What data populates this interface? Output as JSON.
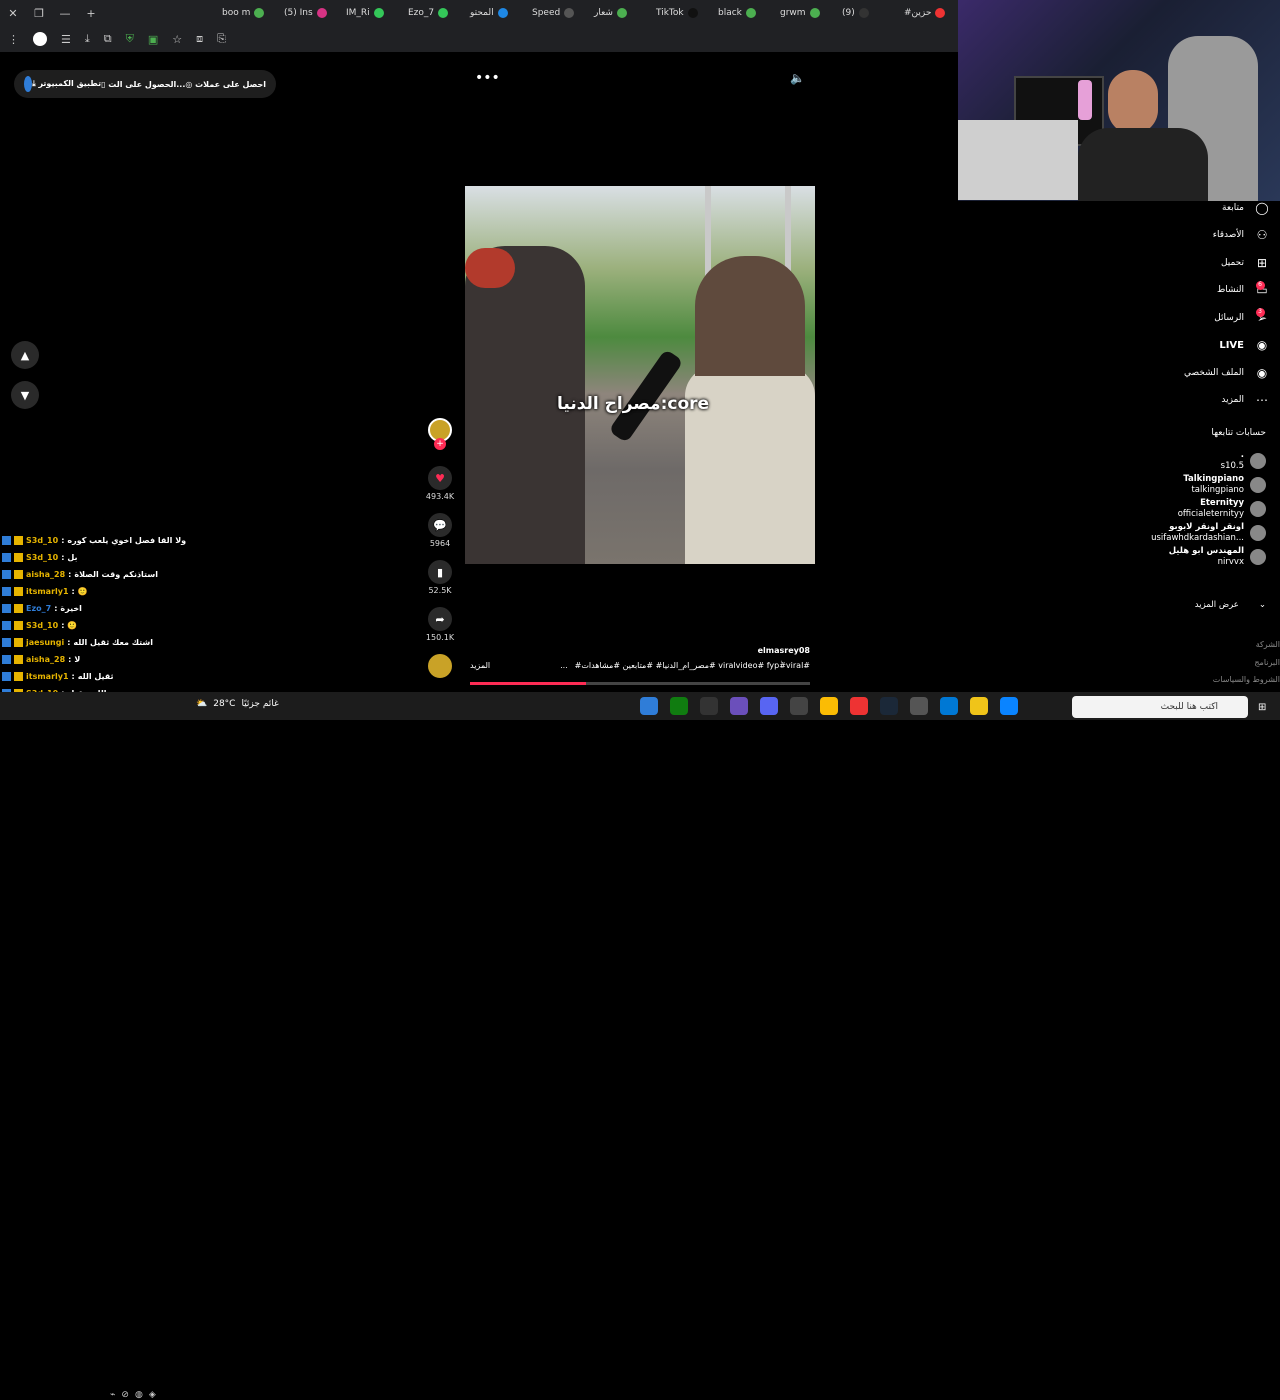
{
  "browser": {
    "tabs": [
      {
        "label": "‎#حزين",
        "color": "#e33"
      },
      {
        "label": "(9)",
        "color": "#333"
      },
      {
        "label": "grwm",
        "color": "#4caf50"
      },
      {
        "label": "black",
        "color": "#4caf50"
      },
      {
        "label": "TikTok",
        "color": "#111"
      },
      {
        "label": "شعار",
        "color": "#4caf50"
      },
      {
        "label": "Speed",
        "color": "#555"
      },
      {
        "label": "المحتو",
        "color": "#1e88e5"
      },
      {
        "label": "Ezo_7",
        "color": "#34c759"
      },
      {
        "label": "IM_Ri",
        "color": "#34c759"
      },
      {
        "label": "(5) Ins",
        "color": "#d63384"
      },
      {
        "label": "boo m",
        "color": "#4caf50"
      }
    ],
    "new_tab": "+",
    "minimize": "—"
  },
  "header": {
    "get_coins": "احصل على عملات",
    "get_app": "الحصول على الت...",
    "pc_app": "تطبيق الكمبيوتر"
  },
  "video": {
    "caption": "مصراح الدنيا:core",
    "likes": "493.4K",
    "comments": "5964",
    "saves": "52.5K",
    "shares": "150.1K",
    "username": "elmasrey08",
    "hashtags": "#مصر_ام_الدنيا# #متابعين #مشاهدات# viralvideo# fyp#ٰviral#",
    "more": "المزيد",
    "ellipsis": "...",
    "progress": 0.34
  },
  "nav": {
    "up": "▲",
    "down": "▼"
  },
  "chat": [
    {
      "user": "S3d_10",
      "user_color": "#e6b400",
      "msg": "ولا القا فصل اخوي يلعب كوره"
    },
    {
      "user": "S3d_10",
      "user_color": "#e6b400",
      "msg": "بل"
    },
    {
      "user": "aisha_28",
      "user_color": "#e6b400",
      "msg": "استاذنكم وقت الصلاة"
    },
    {
      "user": "itsmarly1",
      "user_color": "#e6b400",
      "msg": "🙂"
    },
    {
      "user": "Ezo_7",
      "user_color": "#2f7dd8",
      "msg": "اخيرة"
    },
    {
      "user": "S3d_10",
      "user_color": "#e6b400",
      "msg": "🙂"
    },
    {
      "user": "jaesungi",
      "user_color": "#e6b400",
      "msg": "اشتك معك ثقيل الله"
    },
    {
      "user": "aisha_28",
      "user_color": "#e6b400",
      "msg": "لا"
    },
    {
      "user": "itsmarly1",
      "user_color": "#e6b400",
      "msg": "ثقيل الله"
    },
    {
      "user": "S3d_10",
      "user_color": "#e6b400",
      "msg": "الله يتقبل"
    },
    {
      "user": "w1sarah",
      "user_color": "#e6b400",
      "msg": "اشتك معك ثقيل الله"
    }
  ],
  "sidebar": {
    "items": [
      {
        "label": "متابعة",
        "icon": "following-icon"
      },
      {
        "label": "الأصدقاء",
        "icon": "friends-icon"
      },
      {
        "label": "تحميل",
        "icon": "upload-icon"
      },
      {
        "label": "النشاط",
        "icon": "activity-icon",
        "badge": "6"
      },
      {
        "label": "الرسائل",
        "icon": "messages-icon",
        "badge": "3"
      },
      {
        "label": "LIVE",
        "icon": "live-icon"
      },
      {
        "label": "الملف الشخصي",
        "icon": "profile-icon"
      },
      {
        "label": "المزيد",
        "icon": "more-icon"
      }
    ],
    "following_title": "حسابات تتابعها",
    "following": [
      {
        "name": ".",
        "handle": "s10.5"
      },
      {
        "name": "Talkingpiano",
        "handle": "talkingpiano"
      },
      {
        "name": "Eternityy",
        "handle": "officialeternityy"
      },
      {
        "name": "اونقر اونقر لابوبو",
        "handle": "usifawhdkardashian..."
      },
      {
        "name": "المهندس ابو هليل",
        "handle": "nirvvx"
      }
    ],
    "show_more": "عرض المزيد",
    "footer": [
      "الشركة",
      "البرنامج",
      "الشروط والسياسات"
    ]
  },
  "taskbar": {
    "weather_temp": "28°C",
    "weather_text": "غائم جزئيًا",
    "search_placeholder": "اكتب هنا للبحث"
  }
}
